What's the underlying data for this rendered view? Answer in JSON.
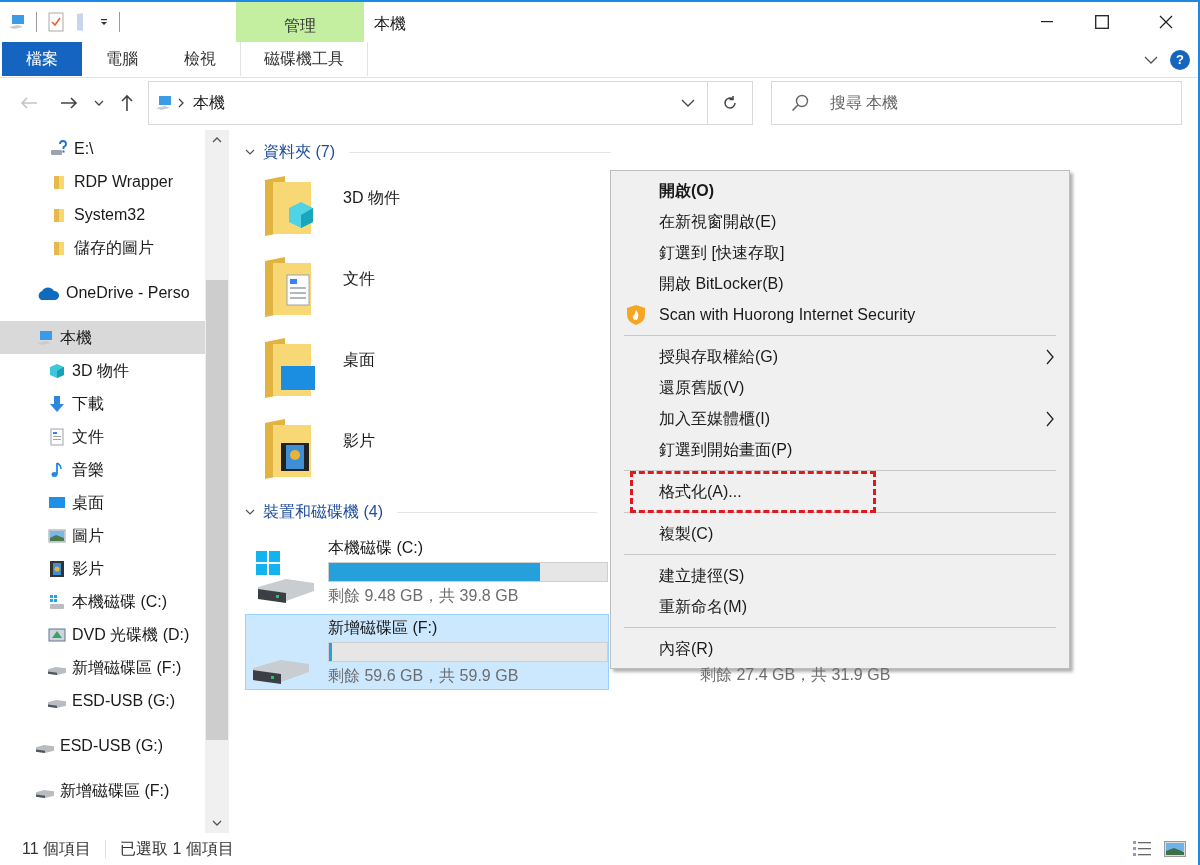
{
  "title_bar": {
    "context_group": "管理",
    "title": "本機",
    "help": "?"
  },
  "ribbon": {
    "tabs": [
      {
        "label": "檔案",
        "kind": "file"
      },
      {
        "label": "電腦",
        "kind": "normal"
      },
      {
        "label": "檢視",
        "kind": "normal"
      },
      {
        "label": "磁碟機工具",
        "kind": "contextual"
      }
    ]
  },
  "address_bar": {
    "path": "本機"
  },
  "search": {
    "placeholder": "搜尋 本機"
  },
  "sidebar": {
    "quick_access_children": [
      {
        "label": "E:\\",
        "kind": "drive-unknown",
        "selected": false
      },
      {
        "label": "RDP Wrapper",
        "kind": "folder",
        "selected": false
      },
      {
        "label": "System32",
        "kind": "folder",
        "selected": false
      },
      {
        "label": "儲存的圖片",
        "kind": "folder",
        "selected": false
      }
    ],
    "items": [
      {
        "label": "OneDrive - Perso",
        "kind": "cloud",
        "selected": false
      },
      {
        "label": "本機",
        "kind": "pc",
        "selected": true,
        "children": [
          {
            "label": "3D 物件",
            "kind": "cube",
            "selected": false
          },
          {
            "label": "下載",
            "kind": "download",
            "selected": false
          },
          {
            "label": "文件",
            "kind": "document",
            "selected": false
          },
          {
            "label": "音樂",
            "kind": "music",
            "selected": false
          },
          {
            "label": "桌面",
            "kind": "desktop",
            "selected": false
          },
          {
            "label": "圖片",
            "kind": "pictures",
            "selected": false
          },
          {
            "label": "影片",
            "kind": "videos",
            "selected": false
          },
          {
            "label": "本機磁碟 (C:)",
            "kind": "windows-drive",
            "selected": false
          },
          {
            "label": "DVD 光碟機 (D:)",
            "kind": "dvd",
            "selected": false
          },
          {
            "label": "新增磁碟區 (F:)",
            "kind": "drive",
            "selected": false
          },
          {
            "label": "ESD-USB (G:)",
            "kind": "drive",
            "selected": false
          }
        ]
      },
      {
        "label": "ESD-USB (G:)",
        "kind": "drive",
        "selected": false
      },
      {
        "label": "新增磁碟區 (F:)",
        "kind": "drive",
        "selected": false
      }
    ]
  },
  "folders_group": {
    "title": "資料夾 (7)",
    "expanded": true,
    "items": [
      {
        "name": "3D 物件",
        "kind": "cube"
      },
      {
        "name": "文件",
        "kind": "document"
      },
      {
        "name": "桌面",
        "kind": "desktop"
      },
      {
        "name": "影片",
        "kind": "videos"
      }
    ]
  },
  "drives_group": {
    "title": "裝置和磁碟機 (4)",
    "expanded": true,
    "items": [
      {
        "name": "本機磁碟 (C:)",
        "kind": "windows-drive",
        "level": 0.76,
        "space": "剩餘 9.48 GB，共 39.8 GB",
        "selected": false
      },
      {
        "name": "新增磁碟區 (F:)",
        "kind": "drive",
        "level": 0.01,
        "space": "剩餘 59.6 GB，共 59.9 GB",
        "selected": true
      },
      {
        "space": "剩餘 27.4 GB，共 31.9 GB",
        "selected": false
      }
    ]
  },
  "context_menu": {
    "items": [
      {
        "kind": "item",
        "label": "開啟(O)",
        "bold": true
      },
      {
        "kind": "item",
        "label": "在新視窗開啟(E)"
      },
      {
        "kind": "item",
        "label": "釘選到 [快速存取]"
      },
      {
        "kind": "item",
        "label": "開啟 BitLocker(B)"
      },
      {
        "kind": "icon-item",
        "label": "Scan with Huorong Internet Security"
      },
      {
        "kind": "separator"
      },
      {
        "kind": "item",
        "label": "授與存取權給(G)",
        "submenu": true
      },
      {
        "kind": "item",
        "label": "還原舊版(V)"
      },
      {
        "kind": "item",
        "label": "加入至媒體櫃(I)",
        "submenu": true
      },
      {
        "kind": "item",
        "label": "釘選到開始畫面(P)"
      },
      {
        "kind": "separator"
      },
      {
        "kind": "item",
        "label": "格式化(A)...",
        "highlighted": true
      },
      {
        "kind": "separator"
      },
      {
        "kind": "item",
        "label": "複製(C)"
      },
      {
        "kind": "separator"
      },
      {
        "kind": "item",
        "label": "建立捷徑(S)"
      },
      {
        "kind": "item",
        "label": "重新命名(M)"
      },
      {
        "kind": "separator"
      },
      {
        "kind": "item",
        "label": "內容(R)"
      }
    ]
  },
  "status_bar": {
    "item_count": "11 個項目",
    "selection": "已選取 1 個項目"
  }
}
